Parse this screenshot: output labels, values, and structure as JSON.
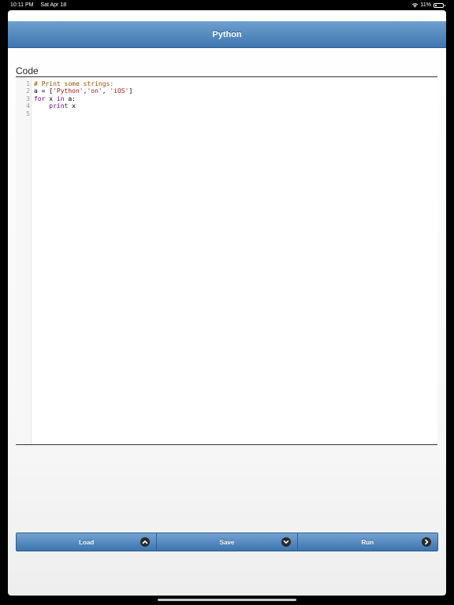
{
  "status_bar": {
    "time": "10:11 PM",
    "date": "Sat Apr 18",
    "battery": "11%",
    "wifi_icon": "wifi-icon",
    "battery_icon": "battery-icon"
  },
  "header": {
    "title": "Python"
  },
  "editor": {
    "label": "Code",
    "line_numbers": [
      "1",
      "2",
      "3",
      "4",
      "5"
    ],
    "lines": [
      [
        {
          "t": "# Print some strings:",
          "k": "comment"
        }
      ],
      [
        {
          "t": "a = [",
          "k": ""
        },
        {
          "t": "'Python'",
          "k": "string"
        },
        {
          "t": ",",
          "k": ""
        },
        {
          "t": "'on'",
          "k": "string"
        },
        {
          "t": ", ",
          "k": ""
        },
        {
          "t": "'iOS'",
          "k": "string"
        },
        {
          "t": "]",
          "k": ""
        }
      ],
      [
        {
          "t": "for",
          "k": "keyword"
        },
        {
          "t": " x ",
          "k": ""
        },
        {
          "t": "in",
          "k": "keyword"
        },
        {
          "t": " a:",
          "k": ""
        }
      ],
      [
        {
          "t": "    ",
          "k": ""
        },
        {
          "t": "print",
          "k": "keyword"
        },
        {
          "t": " x",
          "k": ""
        }
      ],
      [
        {
          "t": "",
          "k": ""
        }
      ]
    ]
  },
  "toolbar": {
    "load_label": "Load",
    "save_label": "Save",
    "run_label": "Run",
    "load_icon": "chevron-up-icon",
    "save_icon": "chevron-down-icon",
    "run_icon": "chevron-right-icon"
  },
  "colors": {
    "header_top": "#6f9fcf",
    "header_bottom": "#3f77b0",
    "comment": "#a05000",
    "string": "#aa1111",
    "keyword": "#770088"
  }
}
